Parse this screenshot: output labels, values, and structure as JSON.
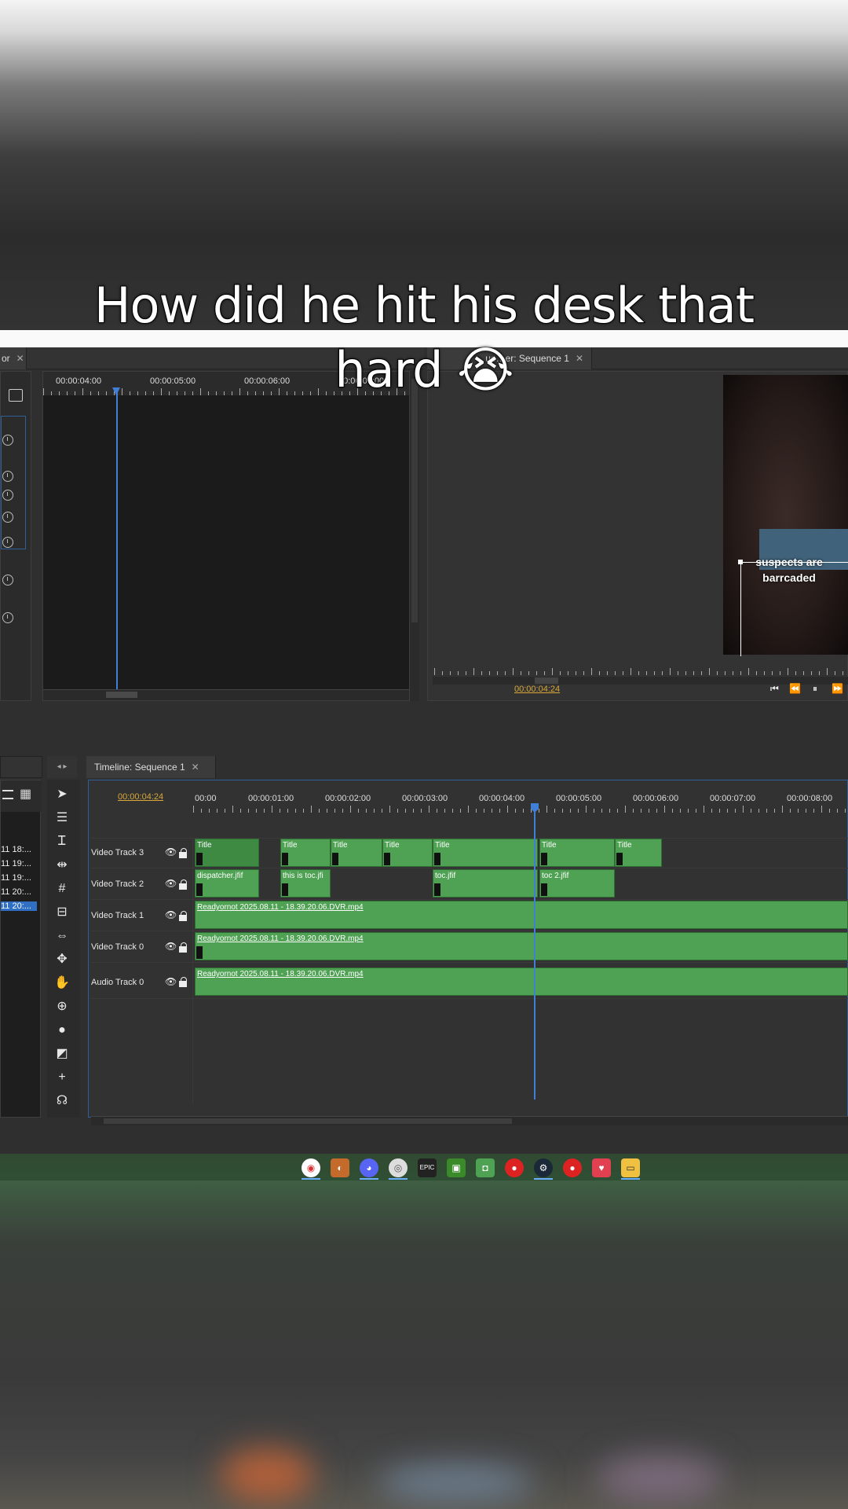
{
  "caption": {
    "line1": "How did he hit his desk that",
    "line2": "hard",
    "emoji": "😭"
  },
  "source_panel": {
    "tab_label": "or",
    "ruler_labels": [
      "00:00:04:00",
      "00:00:05:00",
      "00:00:06:00",
      "00:00:07:00"
    ]
  },
  "sequence_viewer": {
    "tab_label": "ue…er: Sequence 1",
    "timecode": "00:00:04:24",
    "overlay_text_1": "suspects are",
    "overlay_text_2": "barrcaded"
  },
  "media_list": {
    "items": [
      "11 18:...",
      "11 19:...",
      "11 19:...",
      "11 20:...",
      "11 20:..."
    ]
  },
  "timeline": {
    "tab_label": "Timeline: Sequence 1",
    "timecode": "00:00:04:24",
    "ruler_labels": [
      "00:00",
      "00:00:01:00",
      "00:00:02:00",
      "00:00:03:00",
      "00:00:04:00",
      "00:00:05:00",
      "00:00:06:00",
      "00:00:07:00",
      "00:00:08:00"
    ],
    "tracks": [
      {
        "name": "Video Track 3"
      },
      {
        "name": "Video Track 2"
      },
      {
        "name": "Video Track 1"
      },
      {
        "name": "Video Track 0"
      },
      {
        "name": "Audio Track 0"
      }
    ],
    "clips": {
      "v3": [
        "Title",
        "Title",
        "Title",
        "Title",
        "Title",
        "Title",
        "Title"
      ],
      "v2": [
        "dispatcher.jfif",
        "this is toc.jfi",
        "toc.jfif",
        "toc 2.jfif"
      ],
      "v1": "Readyornot 2025.08.11 - 18.39.20.06.DVR.mp4",
      "v0": "Readyornot 2025.08.11 - 18.39.20.06.DVR.mp4",
      "a0": "Readyornot 2025.08.11 - 18.39.20.06.DVR.mp4"
    }
  },
  "taskbar": {
    "icons": [
      "chrome-icon",
      "obs-icon",
      "discord-icon",
      "chrome-alt-icon",
      "epic-games-icon",
      "minecraft-icon",
      "app-icon",
      "red-app-icon",
      "steam-icon",
      "red-app-2-icon",
      "pocket-icon",
      "file-explorer-icon"
    ]
  },
  "colors": {
    "clip_green": "#4fa153",
    "playhead": "#3f7fd6",
    "timecode_yellow": "#d9a83a"
  }
}
